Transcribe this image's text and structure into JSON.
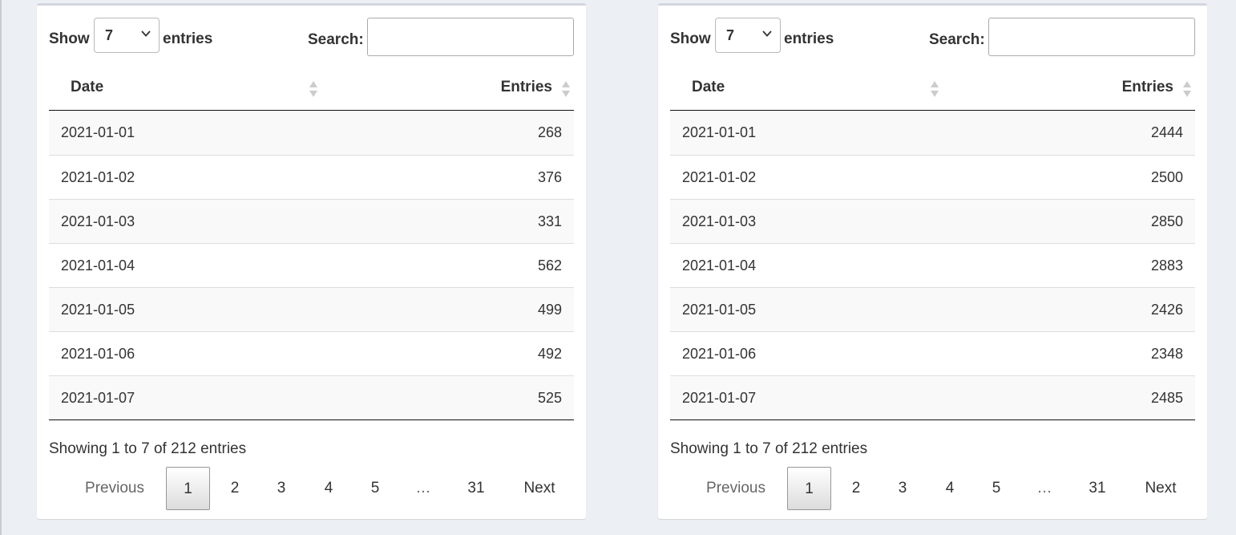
{
  "tables": [
    {
      "length_label": "Show",
      "length_value": "7",
      "entries_label": "entries",
      "search_label": "Search:",
      "search_value": "",
      "columns": {
        "date": "Date",
        "entries": "Entries"
      },
      "rows": [
        {
          "date": "2021-01-01",
          "entries": "268"
        },
        {
          "date": "2021-01-02",
          "entries": "376"
        },
        {
          "date": "2021-01-03",
          "entries": "331"
        },
        {
          "date": "2021-01-04",
          "entries": "562"
        },
        {
          "date": "2021-01-05",
          "entries": "499"
        },
        {
          "date": "2021-01-06",
          "entries": "492"
        },
        {
          "date": "2021-01-07",
          "entries": "525"
        }
      ],
      "info": "Showing 1 to 7 of 212 entries",
      "pagination": {
        "previous": "Previous",
        "pages": [
          "1",
          "2",
          "3",
          "4",
          "5",
          "…",
          "31"
        ],
        "next": "Next",
        "current": "1"
      }
    },
    {
      "length_label": "Show",
      "length_value": "7",
      "entries_label": "entries",
      "search_label": "Search:",
      "search_value": "",
      "columns": {
        "date": "Date",
        "entries": "Entries"
      },
      "rows": [
        {
          "date": "2021-01-01",
          "entries": "2444"
        },
        {
          "date": "2021-01-02",
          "entries": "2500"
        },
        {
          "date": "2021-01-03",
          "entries": "2850"
        },
        {
          "date": "2021-01-04",
          "entries": "2883"
        },
        {
          "date": "2021-01-05",
          "entries": "2426"
        },
        {
          "date": "2021-01-06",
          "entries": "2348"
        },
        {
          "date": "2021-01-07",
          "entries": "2485"
        }
      ],
      "info": "Showing 1 to 7 of 212 entries",
      "pagination": {
        "previous": "Previous",
        "pages": [
          "1",
          "2",
          "3",
          "4",
          "5",
          "…",
          "31"
        ],
        "next": "Next",
        "current": "1"
      }
    }
  ]
}
